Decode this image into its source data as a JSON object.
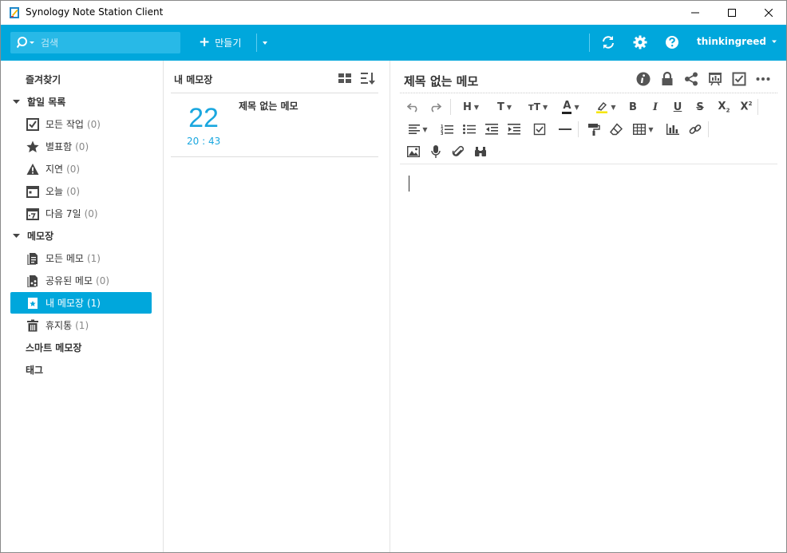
{
  "window": {
    "title": "Synology Note Station Client"
  },
  "toolbar": {
    "search_placeholder": "검색",
    "create_label": "만들기",
    "username": "thinkingreed"
  },
  "sidebar": {
    "favorites": "즐겨찾기",
    "todo_header": "할일 목록",
    "todo_items": [
      {
        "label": "모든 작업",
        "count": "(0)"
      },
      {
        "label": "별표함",
        "count": "(0)"
      },
      {
        "label": "지연",
        "count": "(0)"
      },
      {
        "label": "오늘",
        "count": "(0)"
      },
      {
        "label": "다음 7일",
        "count": "(0)"
      }
    ],
    "notebook_header": "메모장",
    "notebook_items": [
      {
        "label": "모든 메모",
        "count": "(1)"
      },
      {
        "label": "공유된 메모",
        "count": "(0)"
      },
      {
        "label": "내 메모장",
        "count": "(1)"
      },
      {
        "label": "휴지통",
        "count": "(1)"
      }
    ],
    "smart_notebook": "스마트 메모장",
    "tags": "태그"
  },
  "note_list": {
    "title": "내 메모장",
    "notes": [
      {
        "day": "22",
        "time": "20 : 43",
        "title": "제목 없는 메모"
      }
    ]
  },
  "editor": {
    "title": "제목 없는 메모"
  },
  "colors": {
    "accent": "#00a7dc",
    "search_bg": "#28b9e7"
  }
}
